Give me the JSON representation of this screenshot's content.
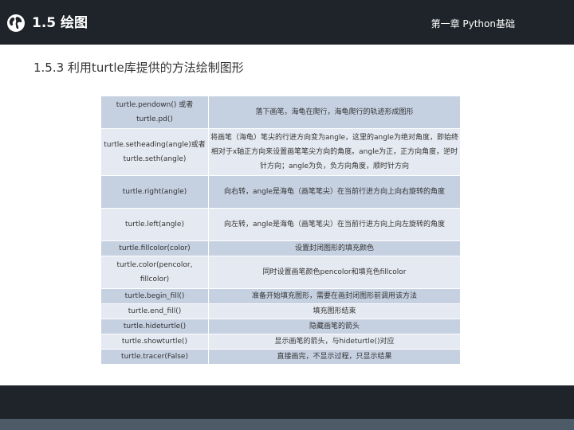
{
  "header": {
    "section_title": "1.5 绘图",
    "chapter": "第一章 Python基础"
  },
  "subtitle": "1.5.3 利用turtle库提供的方法绘制图形",
  "table": {
    "rows": [
      {
        "method": "turtle.pendown() 或者 turtle.pd()",
        "description": "落下画笔，海龟在爬行，海龟爬行的轨迹形成图形"
      },
      {
        "method": "turtle.setheading(angle)或者 turtle.seth(angle)",
        "description": "将画笔（海龟）笔尖的行进方向变为angle，这里的angle为绝对角度，即始终相对于x轴正方向来设置画笔笔尖方向的角度。angle为正，正方向角度，逆时针方向；angle为负，负方向角度，顺时针方向"
      },
      {
        "method": "turtle.right(angle)",
        "description": "向右转，angle是海龟（画笔笔尖）在当前行进方向上向右旋转的角度"
      },
      {
        "method": "turtle.left(angle)",
        "description": "向左转，angle是海龟（画笔笔尖）在当前行进方向上向左旋转的角度"
      },
      {
        "method": "turtle.fillcolor(color)",
        "description": "设置封闭图形的填充颜色"
      },
      {
        "method": "turtle.color(pencolor, fillcolor)",
        "description": "同时设置画笔颜色pencolor和填充色fillcolor"
      },
      {
        "method": "turtle.begin_fill()",
        "description": "准备开始填充图形，需要在画封闭图形前调用该方法"
      },
      {
        "method": "turtle.end_fill()",
        "description": "填充图形结束"
      },
      {
        "method": "turtle.hideturtle()",
        "description": "隐藏画笔的箭头"
      },
      {
        "method": "turtle.showturtle()",
        "description": "显示画笔的箭头，与hideturtle()对应"
      },
      {
        "method": "turtle.tracer(False)",
        "description": "直接画完，不显示过程，只显示结果"
      }
    ]
  },
  "colors": {
    "header_bg": "#1e2429",
    "row_dark": "#c5d0e1",
    "row_light": "#e5e9f1",
    "footer_stripe": "#4d5a68"
  }
}
